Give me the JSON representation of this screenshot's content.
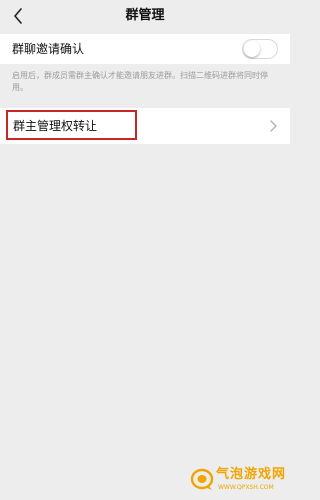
{
  "nav": {
    "title": "群管理",
    "back_icon": "chevron-left-icon"
  },
  "settings": {
    "invite_confirm": {
      "label": "群聊邀请确认",
      "enabled": false
    },
    "description": "启用后，群成员需群主确认才能邀请朋友进群。扫描二维码进群将同时停用。",
    "transfer": {
      "label": "群主管理权转让",
      "chevron_icon": "chevron-right-icon"
    }
  },
  "watermark": {
    "name": "气泡游戏网",
    "url": "WWW.QPXSH.COM"
  },
  "colors": {
    "background": "#ededed",
    "highlight_border": "#c62828",
    "watermark": "#f0a500"
  }
}
